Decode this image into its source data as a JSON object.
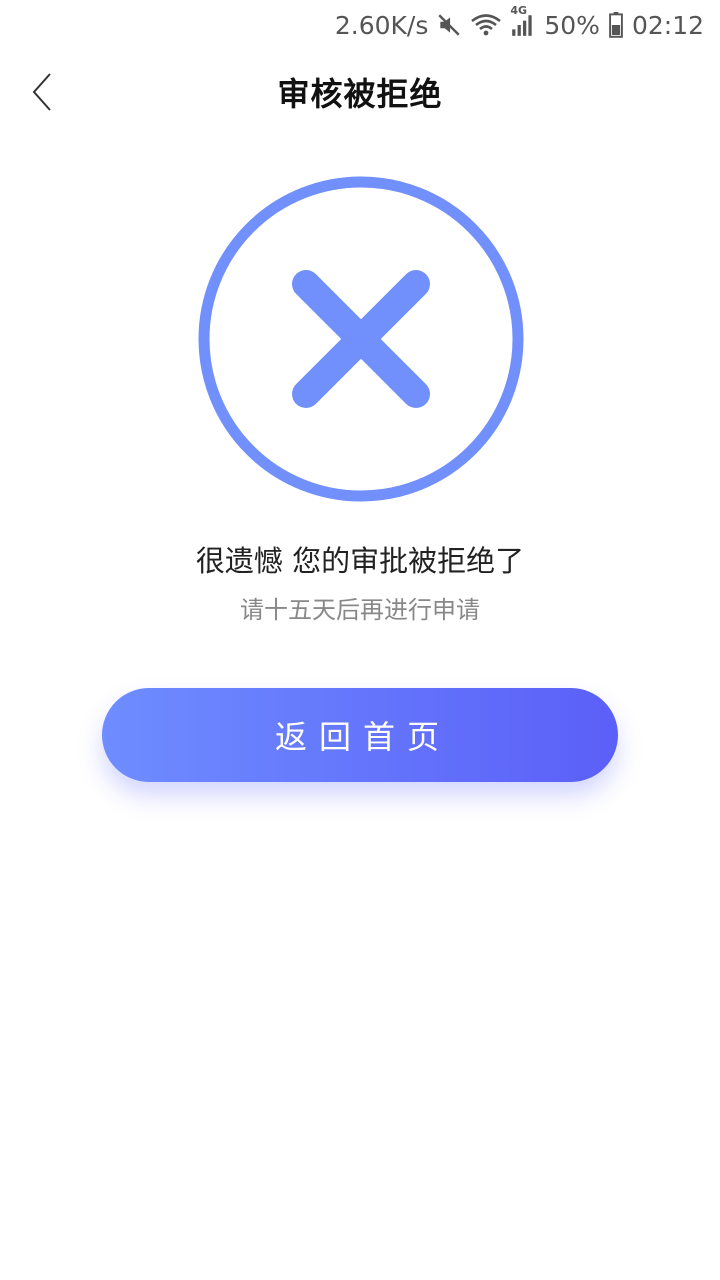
{
  "status_bar": {
    "net_speed": "2.60K/s",
    "network_type": "4G",
    "battery": "50%",
    "time": "02:12",
    "icons": [
      "mute-icon",
      "wifi-icon",
      "signal-icon",
      "battery-icon"
    ]
  },
  "header": {
    "title": "审核被拒绝",
    "back_icon": "chevron-left-icon"
  },
  "result": {
    "icon": "close-circle-icon",
    "icon_color": "#7190fb",
    "message": "很遗憾 您的审批被拒绝了",
    "sub_message": "请十五天后再进行申请"
  },
  "actions": {
    "home_label": "返回首页",
    "gradient_start": "#6e8dff",
    "gradient_end": "#5b5ff8"
  }
}
